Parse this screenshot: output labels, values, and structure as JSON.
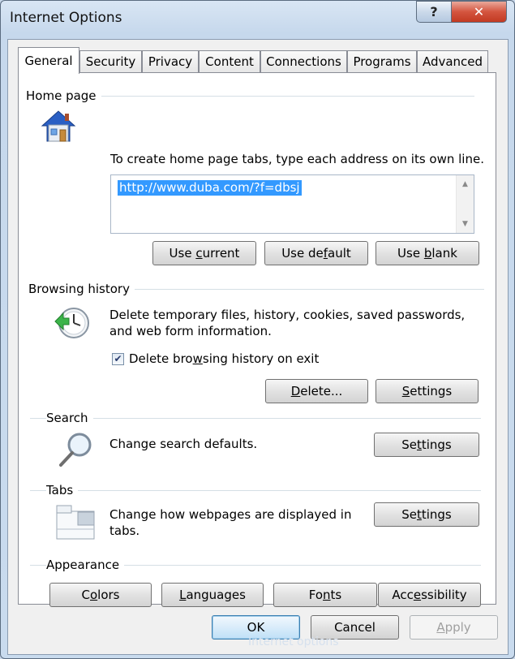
{
  "window": {
    "title": "Internet Options",
    "help_label": "?",
    "close_label": "✕",
    "caption_watermark": "Internet options"
  },
  "tabs": [
    {
      "label": "General",
      "active": true
    },
    {
      "label": "Security"
    },
    {
      "label": "Privacy"
    },
    {
      "label": "Content"
    },
    {
      "label": "Connections"
    },
    {
      "label": "Programs"
    },
    {
      "label": "Advanced"
    }
  ],
  "home_page": {
    "heading": "Home page",
    "icon": "house-icon",
    "instruction": "To create home page tabs, type each address on its own line.",
    "url": "http://www.duba.com/?f=dbsj",
    "buttons": {
      "use_current": {
        "pre": "Use ",
        "key": "c",
        "post": "urrent"
      },
      "use_default": {
        "pre": "Use de",
        "key": "f",
        "post": "ault"
      },
      "use_blank": {
        "pre": "Use ",
        "key": "b",
        "post": "lank"
      }
    }
  },
  "browsing_history": {
    "heading": "Browsing history",
    "icon": "history-clock-icon",
    "description_line1": "Delete temporary files, history, cookies, saved passwords,",
    "description_line2": "and web form information.",
    "checkbox": {
      "pre": "Delete bro",
      "key": "w",
      "post": "sing history on exit",
      "checked": true
    },
    "delete_button": {
      "pre": "",
      "key": "D",
      "post": "elete..."
    },
    "settings_button": {
      "pre": "",
      "key": "S",
      "post": "ettings"
    }
  },
  "search": {
    "heading": "Search",
    "icon": "magnifier-icon",
    "description": "Change search defaults.",
    "settings_button": {
      "pre": "Se",
      "key": "t",
      "post": "tings"
    }
  },
  "tabs_section": {
    "heading": "Tabs",
    "icon": "tabs-window-icon",
    "description_line1": "Change how webpages are displayed in",
    "description_line2": "tabs.",
    "settings_button": {
      "pre": "Se",
      "key": "t",
      "post": "tings"
    }
  },
  "appearance": {
    "heading": "Appearance",
    "colors": {
      "pre": "C",
      "key": "o",
      "post": "lors"
    },
    "languages": {
      "pre": "",
      "key": "L",
      "post": "anguages"
    },
    "fonts": {
      "pre": "Fo",
      "key": "n",
      "post": "ts"
    },
    "accessibility": {
      "pre": "Acc",
      "key": "e",
      "post": "ssibility"
    }
  },
  "footer": {
    "ok": "OK",
    "cancel": "Cancel",
    "apply": {
      "pre": "",
      "key": "A",
      "post": "pply"
    }
  }
}
